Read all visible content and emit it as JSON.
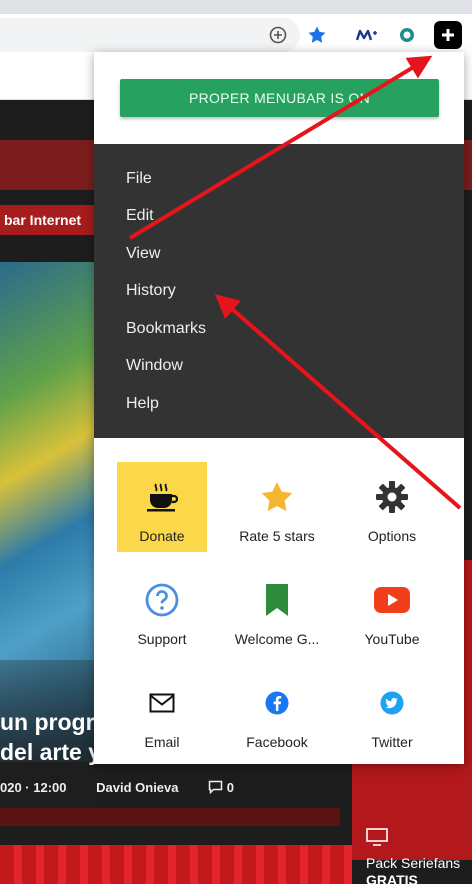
{
  "extension": {
    "status_button": "PROPER MENUBAR IS ON",
    "menu": [
      "File",
      "Edit",
      "View",
      "History",
      "Bookmarks",
      "Window",
      "Help"
    ],
    "tiles": [
      {
        "label": "Donate",
        "icon": "coffee-cup-icon"
      },
      {
        "label": "Rate 5 stars",
        "icon": "star-icon"
      },
      {
        "label": "Options",
        "icon": "gear-icon"
      },
      {
        "label": "Support",
        "icon": "help-circle-icon"
      },
      {
        "label": "Welcome G...",
        "icon": "bookmark-icon"
      },
      {
        "label": "YouTube",
        "icon": "youtube-icon"
      },
      {
        "label": "Email",
        "icon": "email-icon"
      },
      {
        "label": "Facebook",
        "icon": "facebook-icon"
      },
      {
        "label": "Twitter",
        "icon": "twitter-icon"
      }
    ],
    "colors": {
      "status_green": "#27a15f",
      "menu_bg": "#333333",
      "donate_yellow": "#fbd84a",
      "arrow_red": "#e8141c"
    }
  },
  "toolbar": {
    "icons": [
      "add-circle-icon",
      "bookmark-star-icon",
      "movistar-plus-icon",
      "extension-circle-icon",
      "proper-menubar-extension-icon"
    ]
  },
  "website": {
    "nav_text": "bar Internet",
    "headline_line1": "un progr",
    "headline_line2": "del arte y",
    "date": "020 · 12:00",
    "author": "David Onieva",
    "comments": "0",
    "side_text_line1": "Pack Seriefans",
    "side_text_line2": "GRATIS"
  }
}
